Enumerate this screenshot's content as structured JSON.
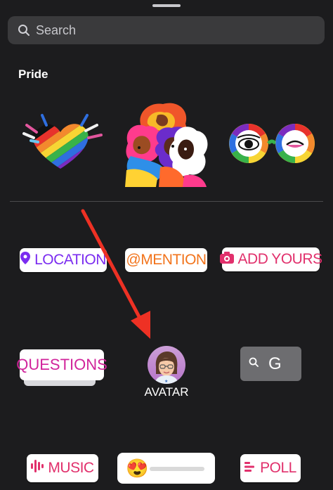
{
  "search": {
    "placeholder": "Search",
    "icon": "search-icon"
  },
  "section": {
    "title": "Pride"
  },
  "pride_stickers": [
    {
      "name": "rainbow-heart-sticker"
    },
    {
      "name": "pride-women-sticker"
    },
    {
      "name": "rainbow-glasses-sticker"
    }
  ],
  "stickers": {
    "location": {
      "label": "LOCATION",
      "icon": "location-pin-icon"
    },
    "mention": {
      "label": "@MENTION"
    },
    "add_yours": {
      "label": "ADD YOURS",
      "icon": "camera-icon"
    },
    "questions": {
      "label": "QUESTIONS"
    },
    "avatar": {
      "label": "AVATAR"
    },
    "gif": {
      "label": "G",
      "icon": "search-icon"
    },
    "music": {
      "label": "MUSIC",
      "icon": "music-bars-icon"
    },
    "slider": {
      "emoji": "😍",
      "icon": "heart-eyes-emoji"
    },
    "poll": {
      "label": "POLL",
      "icon": "poll-lines-icon"
    }
  },
  "colors": {
    "background": "#1c1c1e",
    "search_bg": "#3a3a3c",
    "arrow": "#ee3124"
  }
}
